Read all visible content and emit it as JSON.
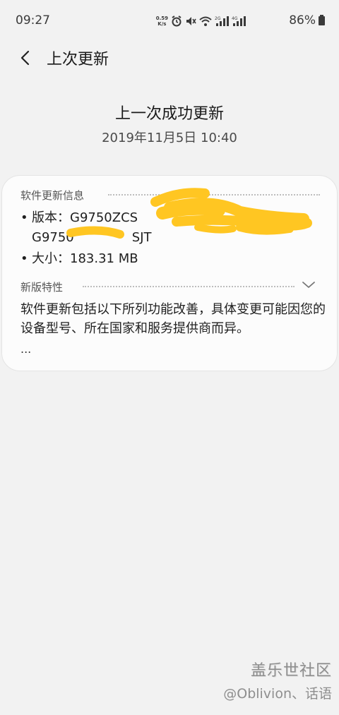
{
  "status_bar": {
    "time": "09:27",
    "net_speed_value": "0.59",
    "net_speed_unit": "K/s",
    "battery": "86%"
  },
  "header": {
    "title": "上次更新",
    "back_icon": "chevron-left-icon"
  },
  "summary": {
    "title": "上一次成功更新",
    "date": "2019年11月5日 10:40"
  },
  "card": {
    "info_header": "软件更新信息",
    "version_label": "版本：G9750ZCS",
    "version_line2": "G9750",
    "version_line2_end": "SJT",
    "size_label": "大小：183.31 MB",
    "bullet": "•",
    "features_header": "新版特性",
    "description": "软件更新包括以下所列功能改善，具体变更可能因您的设备型号、所在国家和服务提供商而异。",
    "ellipsis": "..."
  },
  "watermark": {
    "title": "盖乐世社区",
    "subtitle": "@Oblivion、话语"
  },
  "colors": {
    "background": "#f2f2f2",
    "card": "#fcfcfc",
    "redaction": "#ffc622"
  }
}
